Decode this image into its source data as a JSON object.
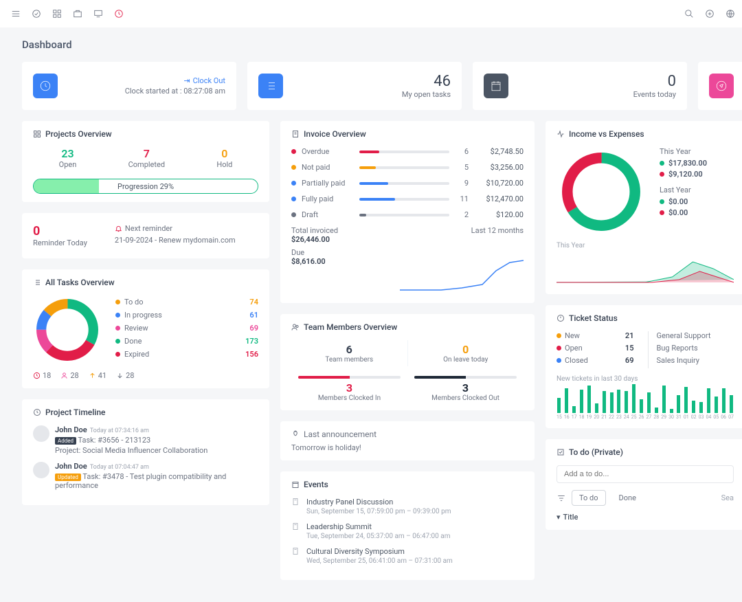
{
  "page": {
    "title": "Dashboard"
  },
  "top_stats": {
    "clock": {
      "out_label": "Clock Out",
      "sub_prefix": "Clock started at : ",
      "time": "08:27:08 am"
    },
    "open_tasks": {
      "value": "46",
      "label": "My open tasks"
    },
    "events_today": {
      "value": "0",
      "label": "Events today"
    }
  },
  "projects_overview": {
    "title": "Projects Overview",
    "stats": [
      {
        "value": "23",
        "label": "Open",
        "color": "#10b981"
      },
      {
        "value": "7",
        "label": "Completed",
        "color": "#e11d48"
      },
      {
        "value": "0",
        "label": "Hold",
        "color": "#f59e0b"
      }
    ],
    "progress_label": "Progression 29%",
    "progress_pct": 29
  },
  "reminder": {
    "num": "0",
    "label": "Reminder Today",
    "next_label": "Next reminder",
    "next_text": "21-09-2024 - Renew mydomain.com"
  },
  "invoice": {
    "title": "Invoice Overview",
    "rows": [
      {
        "label": "Overdue",
        "count": "6",
        "amount": "$2,748.50",
        "color": "#e11d48",
        "pct": 22
      },
      {
        "label": "Not paid",
        "count": "5",
        "amount": "$3,256.00",
        "color": "#f59e0b",
        "pct": 18
      },
      {
        "label": "Partially paid",
        "count": "9",
        "amount": "$10,720.00",
        "color": "#3b82f6",
        "pct": 32
      },
      {
        "label": "Fully paid",
        "count": "11",
        "amount": "$12,470.00",
        "color": "#3b82f6",
        "pct": 40
      },
      {
        "label": "Draft",
        "count": "2",
        "amount": "$120.00",
        "color": "#6b7280",
        "pct": 8
      }
    ],
    "total_invoiced_label": "Total invoiced",
    "total_invoiced": "$26,446.00",
    "period_label": "Last 12 months",
    "due_label": "Due",
    "due": "$8,616.00"
  },
  "all_tasks": {
    "title": "All Tasks Overview",
    "rows": [
      {
        "label": "To do",
        "val": "74",
        "color": "#f59e0b"
      },
      {
        "label": "In progress",
        "val": "61",
        "color": "#3b82f6"
      },
      {
        "label": "Review",
        "val": "69",
        "color": "#ec4899"
      },
      {
        "label": "Done",
        "val": "173",
        "color": "#10b981"
      },
      {
        "label": "Expired",
        "val": "156",
        "color": "#e11d48"
      }
    ],
    "meta": {
      "clock": "18",
      "users": "28",
      "up": "41",
      "down": "28"
    }
  },
  "team_members": {
    "title": "Team Members Overview",
    "stats": [
      {
        "num": "6",
        "label": "Team members",
        "color": "#374151"
      },
      {
        "num": "0",
        "label": "On leave today",
        "color": "#f59e0b"
      }
    ],
    "subs": [
      {
        "num": "3",
        "label": "Members Clocked In",
        "color": "#e11d48",
        "pct": 50
      },
      {
        "num": "3",
        "label": "Members Clocked Out",
        "color": "#1f2937",
        "pct": 50
      }
    ]
  },
  "announcement": {
    "title": "Last announcement",
    "body": "Tomorrow is holiday!"
  },
  "income": {
    "title": "Income vs Expenses",
    "this_year_label": "This Year",
    "this_year": [
      {
        "color": "#10b981",
        "val": "$17,830.00"
      },
      {
        "color": "#e11d48",
        "val": "$9,120.00"
      }
    ],
    "last_year_label": "Last Year",
    "last_year": [
      {
        "color": "#10b981",
        "val": "$0.00"
      },
      {
        "color": "#e11d48",
        "val": "$0.00"
      }
    ],
    "spark_label": "This Year"
  },
  "tickets": {
    "title": "Ticket Status",
    "status": [
      {
        "color": "#f59e0b",
        "label": "New",
        "count": "21"
      },
      {
        "color": "#e11d48",
        "label": "Open",
        "count": "15"
      },
      {
        "color": "#3b82f6",
        "label": "Closed",
        "count": "69"
      }
    ],
    "categories": [
      "General Support",
      "Bug Reports",
      "Sales Inquiry"
    ],
    "bars_label": "New tickets in last 30 days",
    "bars": [
      {
        "x": "15",
        "v": 22
      },
      {
        "x": "16",
        "v": 36
      },
      {
        "x": "17",
        "v": 10
      },
      {
        "x": "18",
        "v": 34
      },
      {
        "x": "19",
        "v": 40
      },
      {
        "x": "20",
        "v": 14
      },
      {
        "x": "21",
        "v": 32
      },
      {
        "x": "22",
        "v": 30
      },
      {
        "x": "23",
        "v": 34
      },
      {
        "x": "24",
        "v": 32
      },
      {
        "x": "25",
        "v": 42
      },
      {
        "x": "26",
        "v": 20
      },
      {
        "x": "27",
        "v": 30
      },
      {
        "x": "28",
        "v": 8
      },
      {
        "x": "29",
        "v": 40
      },
      {
        "x": "30",
        "v": 6
      },
      {
        "x": "31",
        "v": 26
      },
      {
        "x": "01",
        "v": 38
      },
      {
        "x": "02",
        "v": 18
      },
      {
        "x": "03",
        "v": 16
      },
      {
        "x": "04",
        "v": 36
      },
      {
        "x": "05",
        "v": 24
      },
      {
        "x": "06",
        "v": 36
      },
      {
        "x": "07",
        "v": 26
      }
    ]
  },
  "timeline": {
    "title": "Project Timeline",
    "items": [
      {
        "name": "John Doe",
        "time": "Today at 07:34:16 am",
        "tag": "Added",
        "tag_cls": "tag-added",
        "task": "Task: #3656 - 213123",
        "project": "Project: Social Media Influencer Collaboration"
      },
      {
        "name": "John Doe",
        "time": "Today at 07:04:47 am",
        "tag": "Updated",
        "tag_cls": "tag-updated",
        "task": "Task: #3478 - Test plugin compatibility and performance",
        "project": ""
      }
    ]
  },
  "events": {
    "title": "Events",
    "items": [
      {
        "title": "Industry Panel Discussion",
        "sub": "Sun, September 15, 07:59:00 pm – 09:39:00 pm"
      },
      {
        "title": "Leadership Summit",
        "sub": "Tue, September 24, 05:37:00 am – 06:47:00 am"
      },
      {
        "title": "Cultural Diversity Symposium",
        "sub": "Wed, September 25, 06:41:00 am – 07:31:00 am"
      }
    ]
  },
  "todo": {
    "title": "To do (Private)",
    "placeholder": "Add a to do...",
    "tab_todo": "To do",
    "tab_done": "Done",
    "search": "Sea",
    "col_title": "Title"
  },
  "chart_data": [
    {
      "type": "donut",
      "name": "all_tasks",
      "series": [
        {
          "name": "To do",
          "value": 74,
          "color": "#f59e0b"
        },
        {
          "name": "In progress",
          "value": 61,
          "color": "#3b82f6"
        },
        {
          "name": "Review",
          "value": 69,
          "color": "#ec4899"
        },
        {
          "name": "Done",
          "value": 173,
          "color": "#10b981"
        },
        {
          "name": "Expired",
          "value": 156,
          "color": "#e11d48"
        }
      ]
    },
    {
      "type": "donut",
      "name": "income_vs_expenses",
      "series": [
        {
          "name": "Income",
          "value": 17830,
          "color": "#10b981"
        },
        {
          "name": "Expenses",
          "value": 9120,
          "color": "#e11d48"
        }
      ]
    },
    {
      "type": "bar",
      "name": "new_tickets_30d",
      "categories": [
        "15",
        "16",
        "17",
        "18",
        "19",
        "20",
        "21",
        "22",
        "23",
        "24",
        "25",
        "26",
        "27",
        "28",
        "29",
        "30",
        "31",
        "01",
        "02",
        "03",
        "04",
        "05",
        "06",
        "07"
      ],
      "values": [
        22,
        36,
        10,
        34,
        40,
        14,
        32,
        30,
        34,
        32,
        42,
        20,
        30,
        8,
        40,
        6,
        26,
        38,
        18,
        16,
        36,
        24,
        36,
        26
      ]
    }
  ]
}
